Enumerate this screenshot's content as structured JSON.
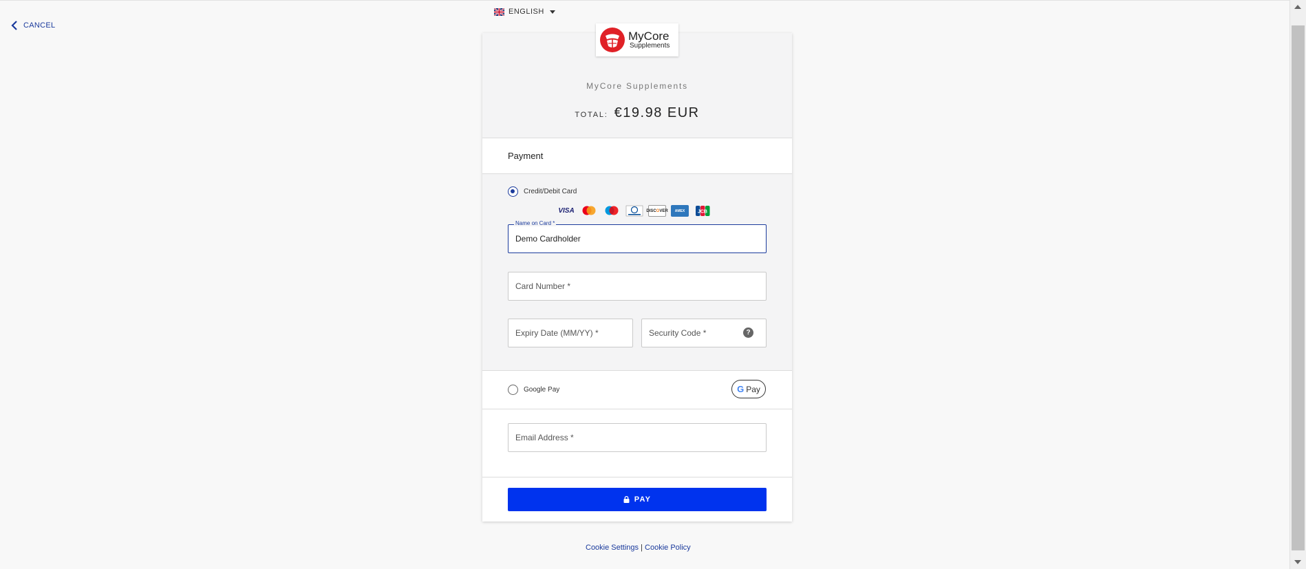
{
  "nav": {
    "cancel_label": "CANCEL"
  },
  "language": {
    "selected": "ENGLISH"
  },
  "merchant": {
    "logo_line1": "MyCore",
    "logo_line2": "Supplements",
    "name": "MyCore Supplements"
  },
  "order": {
    "total_label": "TOTAL:",
    "total_amount": "€19.98 EUR"
  },
  "payment": {
    "title": "Payment",
    "card_option_label": "Credit/Debit Card",
    "card_brands": [
      "visa",
      "mastercard",
      "maestro",
      "diners-club",
      "discover",
      "amex",
      "jcb"
    ],
    "name_label": "Name on Card *",
    "name_value": "Demo Cardholder",
    "card_number_placeholder": "Card Number *",
    "expiry_placeholder": "Expiry Date (MM/YY) *",
    "security_placeholder": "Security Code *",
    "help_glyph": "?",
    "gpay_option_label": "Google Pay",
    "gpay_button_text": "Pay",
    "gpay_button_g": "G",
    "email_placeholder": "Email Address *",
    "pay_button_label": "PAY"
  },
  "footer": {
    "cookie_settings": "Cookie Settings",
    "separator": "|",
    "cookie_policy": "Cookie Policy"
  },
  "colors": {
    "accent": "#1a3a9c",
    "pay_button": "#0033ee",
    "logo_red": "#e02127"
  }
}
